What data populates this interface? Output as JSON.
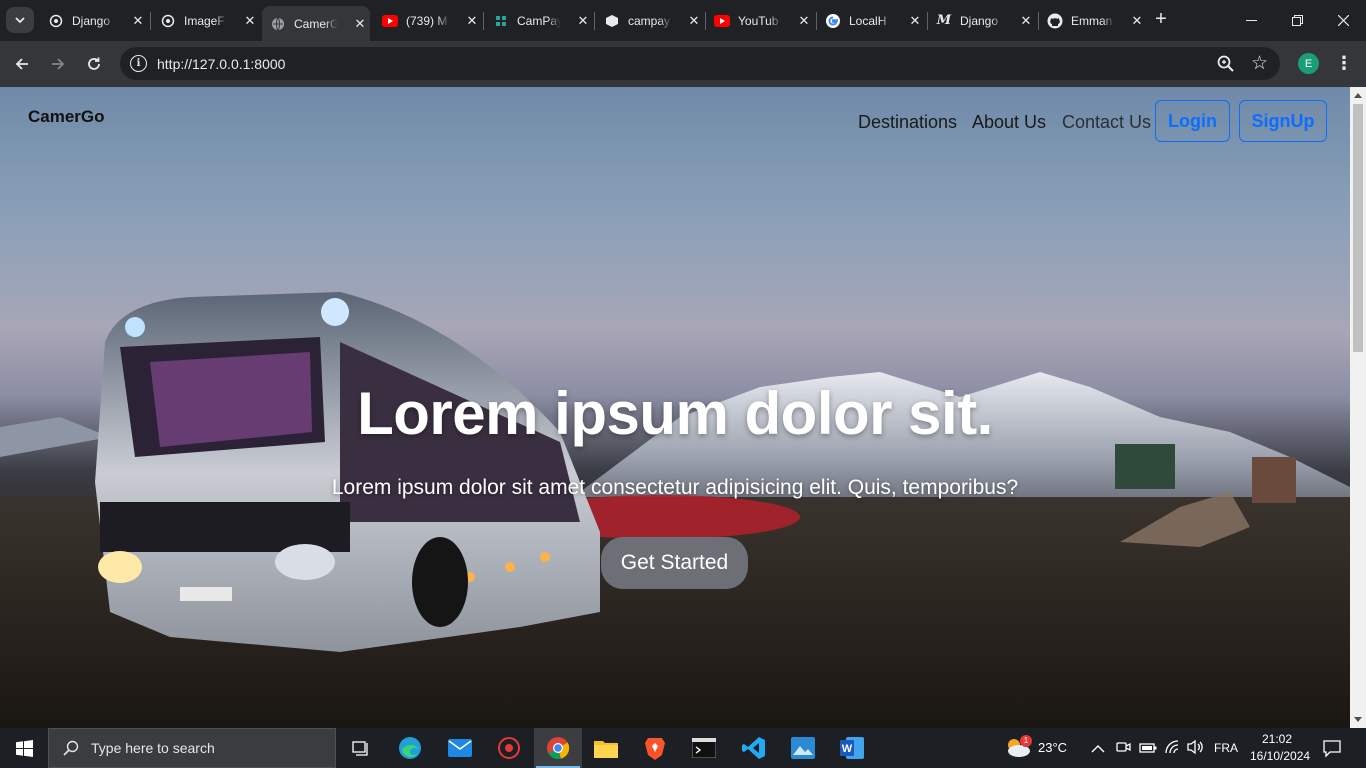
{
  "browser": {
    "tabs": [
      {
        "title": "Django",
        "favicon": "chatgpt-icon",
        "active": false
      },
      {
        "title": "ImageF",
        "favicon": "chatgpt-icon",
        "active": false
      },
      {
        "title": "CamerG",
        "favicon": "globe-icon",
        "active": true
      },
      {
        "title": "(739) M",
        "favicon": "youtube-icon",
        "active": false
      },
      {
        "title": "CamPay",
        "favicon": "campay-icon",
        "active": false
      },
      {
        "title": "campay",
        "favicon": "cube-icon",
        "active": false
      },
      {
        "title": "YouTub",
        "favicon": "youtube-icon",
        "active": false
      },
      {
        "title": "LocalH",
        "favicon": "google-icon",
        "active": false
      },
      {
        "title": "Django",
        "favicon": "medium-icon",
        "active": false
      },
      {
        "title": "Emman",
        "favicon": "github-icon",
        "active": false
      }
    ],
    "url": "http://127.0.0.1:8000",
    "profile_initial": "E"
  },
  "site": {
    "brand": "CamerGo",
    "nav": {
      "destinations": "Destinations",
      "about": "About Us",
      "contact": "Contact Us",
      "login": "Login",
      "signup": "SignUp"
    },
    "hero": {
      "title": "Lorem ipsum dolor sit.",
      "subtitle": "Lorem ipsum dolor sit amet consectetur adipisicing elit. Quis, temporibus?",
      "cta": "Get Started"
    }
  },
  "taskbar": {
    "search_placeholder": "Type here to search",
    "weather_temp": "23°C",
    "weather_badge": "1",
    "language": "FRA",
    "time": "21:02",
    "date": "16/10/2024"
  },
  "colors": {
    "accent_blue": "#0d6efd",
    "cta_bg": "#6c6f76",
    "chrome_bg": "#202124",
    "toolbar_bg": "#35363a"
  }
}
